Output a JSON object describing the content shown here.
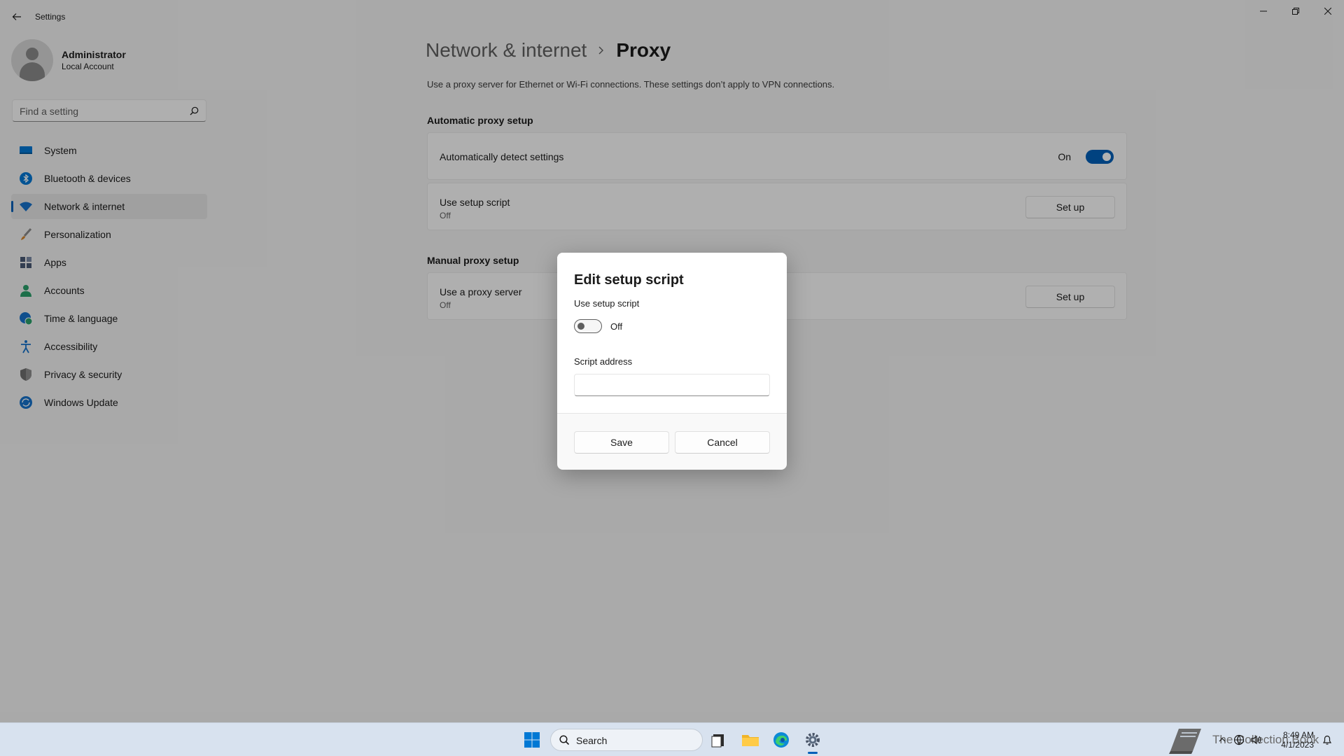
{
  "window": {
    "title": "Settings"
  },
  "profile": {
    "name": "Administrator",
    "account_type": "Local Account"
  },
  "search": {
    "placeholder": "Find a setting"
  },
  "sidebar": {
    "items": [
      {
        "label": "System",
        "icon": "monitor-icon"
      },
      {
        "label": "Bluetooth & devices",
        "icon": "bluetooth-icon"
      },
      {
        "label": "Network & internet",
        "icon": "wifi-icon",
        "active": true
      },
      {
        "label": "Personalization",
        "icon": "brush-icon"
      },
      {
        "label": "Apps",
        "icon": "apps-icon"
      },
      {
        "label": "Accounts",
        "icon": "person-icon"
      },
      {
        "label": "Time & language",
        "icon": "globe-clock-icon"
      },
      {
        "label": "Accessibility",
        "icon": "accessibility-icon"
      },
      {
        "label": "Privacy & security",
        "icon": "shield-icon"
      },
      {
        "label": "Windows Update",
        "icon": "update-icon"
      }
    ]
  },
  "breadcrumb": {
    "parent": "Network & internet",
    "current": "Proxy"
  },
  "main": {
    "description": "Use a proxy server for Ethernet or Wi-Fi connections. These settings don’t apply to VPN connections.",
    "automatic": {
      "title": "Automatic proxy setup",
      "detect": {
        "label": "Automatically detect settings",
        "state": "On"
      },
      "script": {
        "label": "Use setup script",
        "state": "Off",
        "button": "Set up"
      }
    },
    "manual": {
      "title": "Manual proxy setup",
      "proxy": {
        "label": "Use a proxy server",
        "state": "Off",
        "button": "Set up"
      }
    }
  },
  "dialog": {
    "title": "Edit setup script",
    "toggle_label": "Use setup script",
    "toggle_state": "Off",
    "address_label": "Script address",
    "address_value": "",
    "save": "Save",
    "cancel": "Cancel"
  },
  "taskbar": {
    "search_label": "Search",
    "watermark": "The Collection Book",
    "time": "8:49 AM",
    "date": "4/1/2023"
  },
  "colors": {
    "accent": "#005fb8",
    "background": "#f3f3f3",
    "taskbar": "#d8e2ef"
  }
}
